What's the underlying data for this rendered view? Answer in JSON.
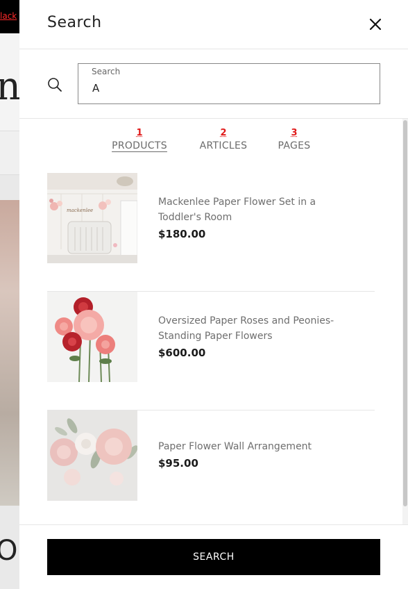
{
  "background": {
    "topbar_link": "lack",
    "logo_fragment": "n",
    "footer_fragment": "O"
  },
  "drawer": {
    "title": "Search",
    "close_icon": "close-icon"
  },
  "search": {
    "label": "Search",
    "value": "A",
    "icon": "search-icon"
  },
  "tabs": [
    {
      "num": "1",
      "label": "PRODUCTS",
      "active": true
    },
    {
      "num": "2",
      "label": "ARTICLES",
      "active": false
    },
    {
      "num": "3",
      "label": "PAGES",
      "active": false
    }
  ],
  "results": [
    {
      "title": "Mackenlee Paper Flower Set in a Toddler's Room",
      "price": "$180.00",
      "image_label": "mackenlee"
    },
    {
      "title": "Oversized Paper Roses and Peonies- Standing Paper Flowers",
      "price": "$600.00"
    },
    {
      "title": "Paper Flower Wall Arrangement",
      "price": "$95.00"
    }
  ],
  "footer": {
    "button_label": "SEARCH"
  },
  "colors": {
    "accent_black": "#000000",
    "tab_number_red": "#e01a1a",
    "muted_text": "#6e6e6e"
  }
}
